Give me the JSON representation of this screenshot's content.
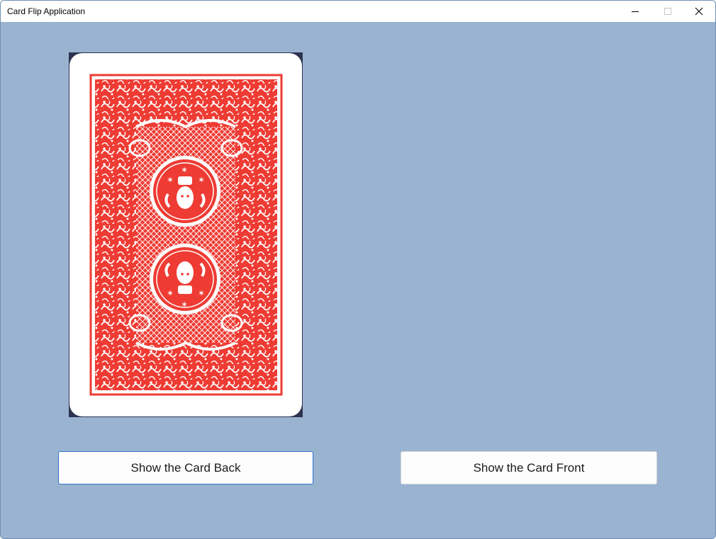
{
  "window": {
    "title": "Card Flip Application"
  },
  "card": {
    "back_color": "#ee3b33"
  },
  "buttons": {
    "show_back": "Show the Card Back",
    "show_front": "Show the Card Front"
  },
  "colors": {
    "background": "#9ab3d1",
    "focus_border": "#2e74c9"
  }
}
